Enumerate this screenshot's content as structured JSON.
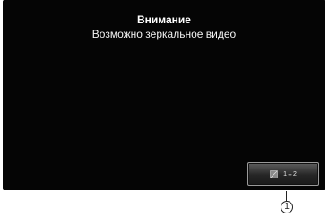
{
  "dialog": {
    "title": "Внимание",
    "message": "Возможно зеркальное видео"
  },
  "swap_button": {
    "label": "1↔2",
    "icon": "camera-swap-icon"
  },
  "callout": {
    "number": "1"
  }
}
